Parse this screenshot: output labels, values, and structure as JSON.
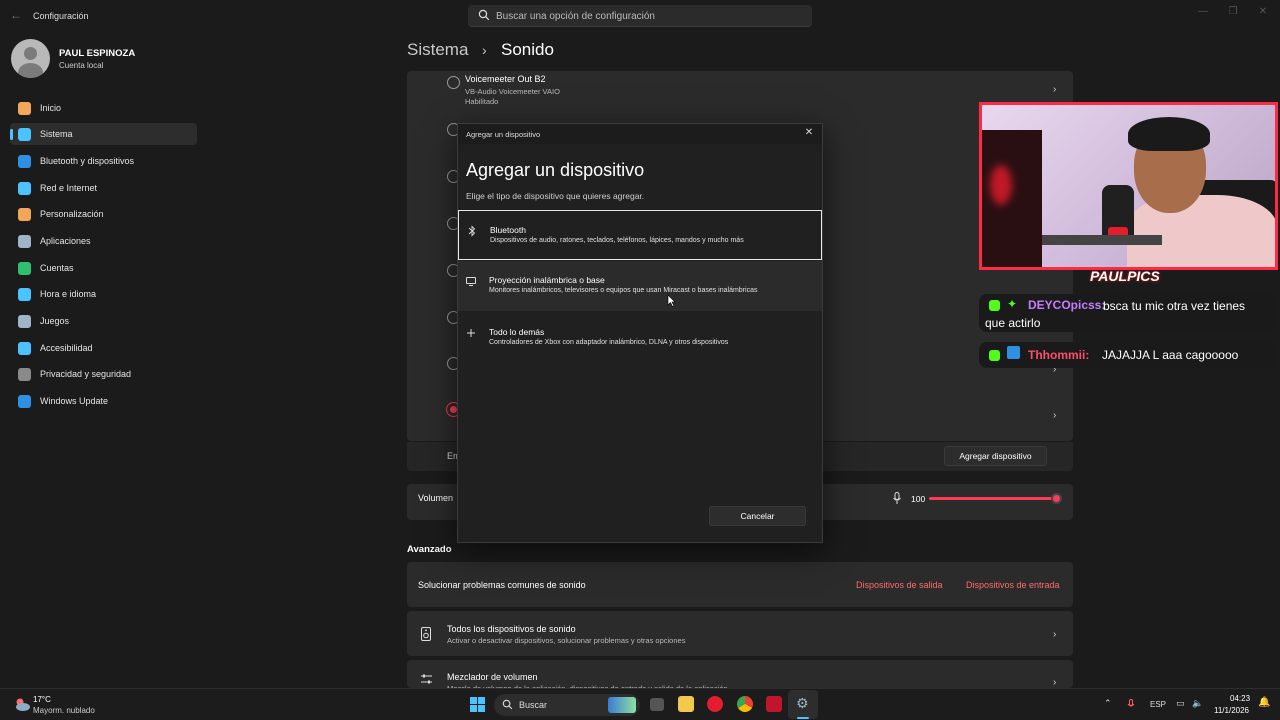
{
  "window": {
    "title": "Configuración",
    "search_placeholder": "Buscar una opción de configuración"
  },
  "user": {
    "name": "PAUL ESPINOZA",
    "type": "Cuenta local"
  },
  "sidebar": {
    "items": [
      {
        "label": "Inicio",
        "icon": "home-icon",
        "color": "#f2a65a"
      },
      {
        "label": "Sistema",
        "icon": "system-icon",
        "color": "#4cc2ff",
        "active": true
      },
      {
        "label": "Bluetooth y dispositivos",
        "icon": "bluetooth-icon",
        "color": "#2f8fe0"
      },
      {
        "label": "Red e Internet",
        "icon": "network-icon",
        "color": "#4cc2ff"
      },
      {
        "label": "Personalización",
        "icon": "brush-icon",
        "color": "#f2a65a"
      },
      {
        "label": "Aplicaciones",
        "icon": "apps-icon",
        "color": "#9fb4c8"
      },
      {
        "label": "Cuentas",
        "icon": "accounts-icon",
        "color": "#2fbf71"
      },
      {
        "label": "Hora e idioma",
        "icon": "globe-icon",
        "color": "#4cc2ff"
      },
      {
        "label": "Juegos",
        "icon": "gamepad-icon",
        "color": "#9fb4c8"
      },
      {
        "label": "Accesibilidad",
        "icon": "accessibility-icon",
        "color": "#4cc2ff"
      },
      {
        "label": "Privacidad y seguridad",
        "icon": "shield-icon",
        "color": "#8a8a8a"
      },
      {
        "label": "Windows Update",
        "icon": "update-icon",
        "color": "#2f8fe0"
      }
    ]
  },
  "breadcrumb": {
    "parent": "Sistema",
    "separator": "›",
    "current": "Sonido"
  },
  "devices": {
    "first": {
      "name": "Voicemeeter Out B2",
      "driver": "VB-Audio Voicemeeter VAIO",
      "status": "Habilitado"
    },
    "pair_partial": "Em",
    "add_device_button": "Agregar dispositivo",
    "volume_label": "Volumen",
    "volume_value": "100",
    "volume_percent": 100
  },
  "advanced": {
    "heading": "Avanzado",
    "troubleshoot": {
      "label": "Solucionar problemas comunes de sonido",
      "output_link": "Dispositivos de salida",
      "input_link": "Dispositivos de entrada"
    },
    "all_devices": {
      "title": "Todos los dispositivos de sonido",
      "desc": "Activar o desactivar dispositivos, solucionar problemas y otras opciones"
    },
    "mixer": {
      "title": "Mezclador de volumen",
      "desc": "Mezcla de volumen de la aplicación, dispositivos de entrada y salida de la aplicación"
    }
  },
  "dialog": {
    "window_title": "Agregar un dispositivo",
    "heading": "Agregar un dispositivo",
    "subtitle": "Elige el tipo de dispositivo que quieres agregar.",
    "options": [
      {
        "title": "Bluetooth",
        "desc": "Dispositivos de audio, ratones, teclados, teléfonos, lápices, mandos y mucho más",
        "icon": "bluetooth-icon"
      },
      {
        "title": "Proyección inalámbrica o base",
        "desc": "Monitores inalámbricos, televisores o equipos que usan Miracast o bases inalámbricas",
        "icon": "monitor-icon"
      },
      {
        "title": "Todo lo demás",
        "desc": "Controladores de Xbox con adaptador inalámbrico, DLNA y otros dispositivos",
        "icon": "plus-icon"
      }
    ],
    "cancel": "Cancelar"
  },
  "stream": {
    "overlay_name": "PAULPICS",
    "chat": [
      {
        "user": "DEYCOpicss:",
        "message": "bsca tu mic otra vez tienes que actirlo",
        "color": "#c77dff"
      },
      {
        "user": "Thhommii:",
        "message": "JAJAJJA L aaa cagooooo",
        "color": "#ff4d6d"
      }
    ]
  },
  "taskbar": {
    "weather_temp": "17°C",
    "weather_desc": "Mayorm. nublado",
    "search_label": "Buscar",
    "lang": "ESP",
    "time": "04:23",
    "date": "11/1/2026"
  }
}
